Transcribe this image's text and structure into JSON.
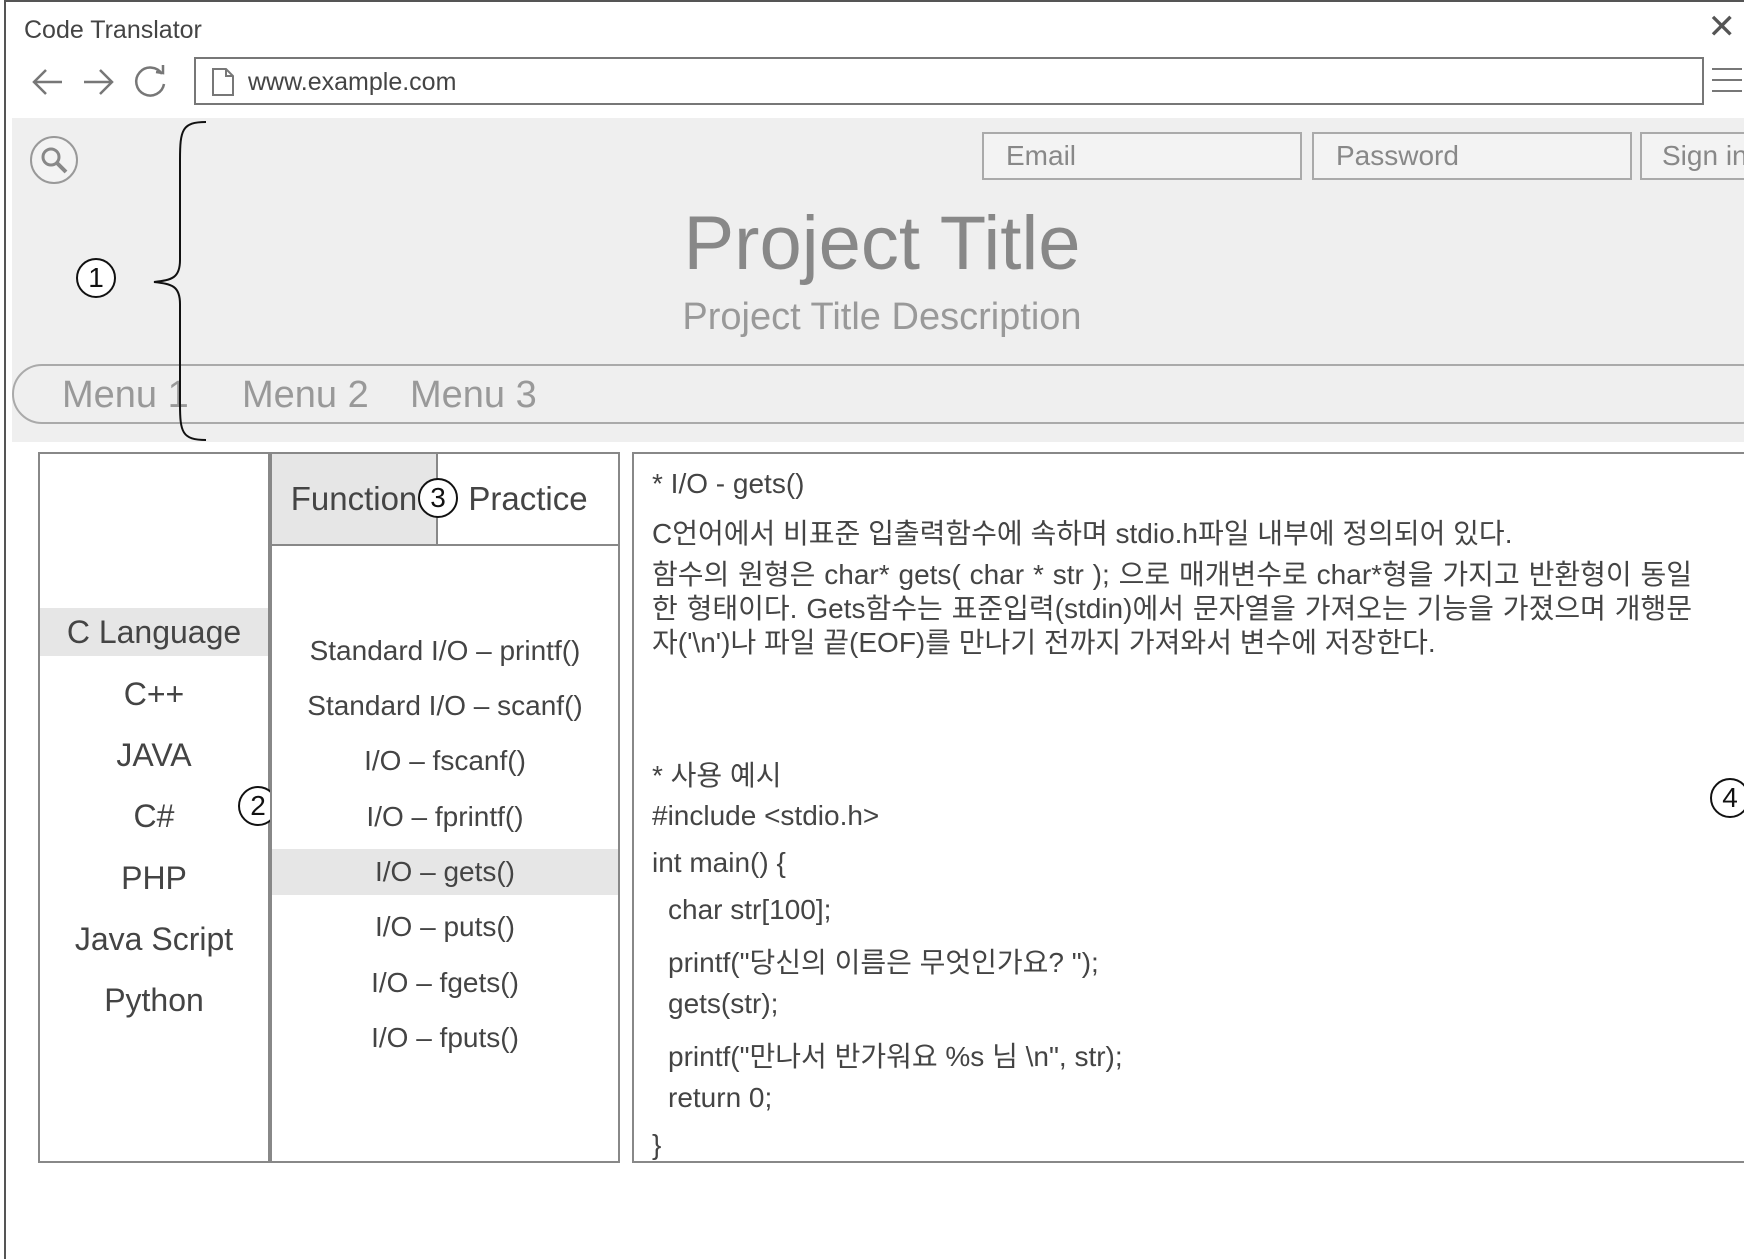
{
  "window": {
    "title": "Code Translator",
    "close_icon": "close-icon",
    "url": "www.example.com"
  },
  "header": {
    "email_placeholder": "Email",
    "password_placeholder": "Password",
    "signin_label": "Sign in",
    "title": "Project Title",
    "description": "Project Title Description",
    "menu": [
      "Menu 1",
      "Menu 2",
      "Menu 3"
    ]
  },
  "annotations": [
    "1",
    "2",
    "3",
    "4"
  ],
  "languages": {
    "items": [
      "C Language",
      "C++",
      "JAVA",
      "C#",
      "PHP",
      "Java Script",
      "Python"
    ],
    "selected": "C Language"
  },
  "functions": {
    "tabs": [
      "Function",
      "Practice"
    ],
    "active_tab": "Function",
    "items": [
      "Standard I/O – printf()",
      "Standard I/O – scanf()",
      "I/O – fscanf()",
      "I/O – fprintf()",
      "I/O – gets()",
      "I/O – puts()",
      "I/O – fgets()",
      "I/O – fputs()"
    ],
    "selected": "I/O – gets()"
  },
  "content": {
    "heading": "* I/O -  gets()",
    "intro": "C언어에서 비표준 입출력함수에 속하며 stdio.h파일 내부에 정의되어 있다.",
    "description": "함수의 원형은 char* gets( char * str ); 으로 매개변수로 char*형을 가지고 반환형이 동일한 형태이다. Gets함수는 표준입력(stdin)에서 문자열을 가져오는 기능을 가졌으며 개행문자('\\n')나 파일 끝(EOF)를 만나기 전까지 가져와서 변수에 저장한다.",
    "example_heading": "* 사용 예시",
    "code": [
      "#include <stdio.h>",
      "int main() {",
      "  char str[100];",
      "  printf(\"당신의 이름은 무엇인가요? \");",
      "  gets(str);",
      "  printf(\"만나서 반가워요 %s 님 \\n\", str);",
      "  return 0;",
      "}"
    ]
  },
  "colors": {
    "header_bg": "#efefef",
    "selected_bg": "#e6e6e6",
    "muted_text": "#888888"
  }
}
